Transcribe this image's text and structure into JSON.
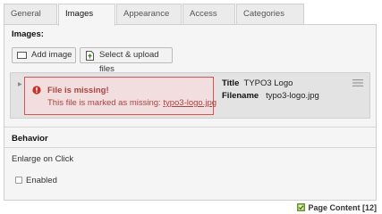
{
  "tabs": [
    "General",
    "Images",
    "Appearance",
    "Access",
    "Categories"
  ],
  "images_section": {
    "title": "Images:",
    "add_image_label": "Add image",
    "select_upload_label": "Select & upload files"
  },
  "file_card": {
    "alert_title": "File is missing!",
    "alert_text": "This file is marked as missing:",
    "alert_link": "typo3-logo.jpg",
    "title_label": "Title",
    "title_value": "TYPO3 Logo",
    "filename_label": "Filename",
    "filename_value": "typo3-logo.jpg"
  },
  "behavior": {
    "title": "Behavior",
    "enlarge_label": "Enlarge on Click",
    "enabled_label": "Enabled"
  },
  "footer": {
    "label": "Page Content [12]"
  }
}
